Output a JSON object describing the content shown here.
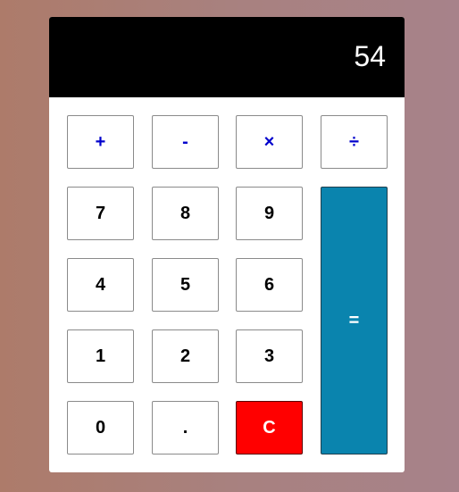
{
  "display": {
    "value": "54"
  },
  "operators": {
    "add": "+",
    "subtract": "-",
    "multiply": "×",
    "divide": "÷"
  },
  "digits": {
    "d7": "7",
    "d8": "8",
    "d9": "9",
    "d4": "4",
    "d5": "5",
    "d6": "6",
    "d1": "1",
    "d2": "2",
    "d3": "3",
    "d0": "0",
    "decimal": "."
  },
  "actions": {
    "clear": "C",
    "equals": "="
  },
  "colors": {
    "operator_text": "#0000cc",
    "clear_bg": "#ff0000",
    "equals_bg": "#0a84ae",
    "display_bg": "#000000"
  }
}
